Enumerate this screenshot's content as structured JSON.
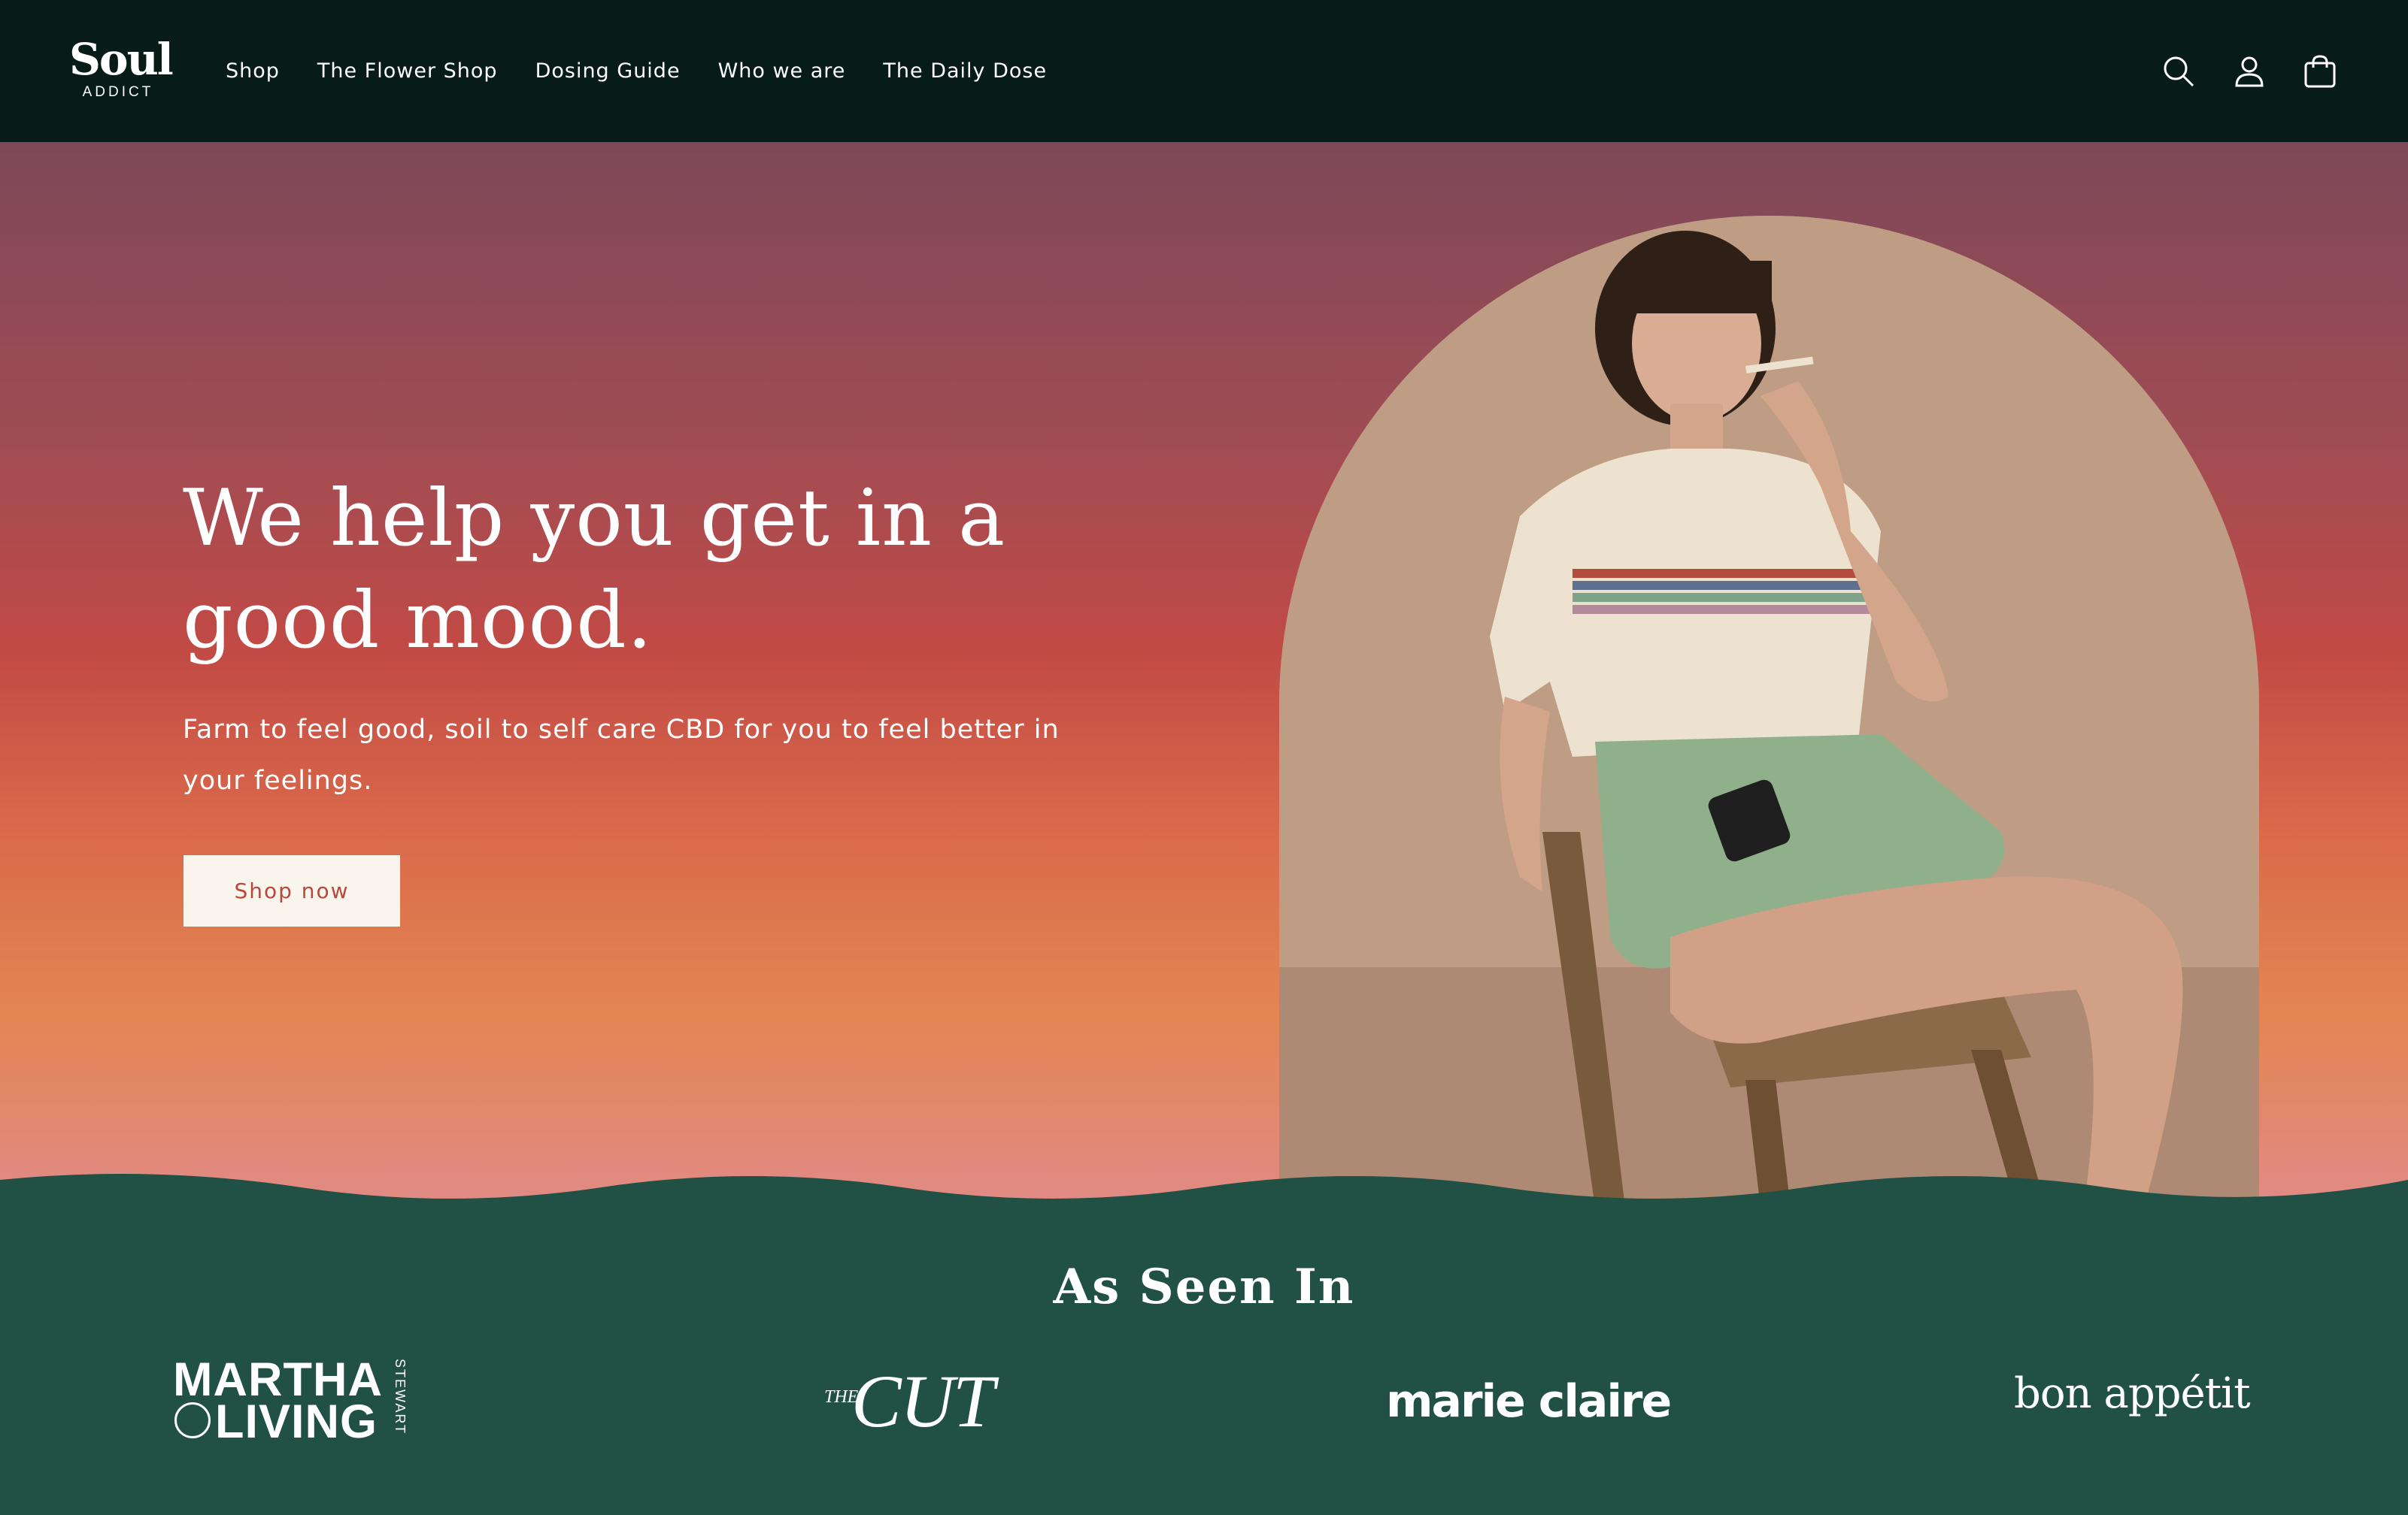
{
  "header": {
    "logo_main": "Soul",
    "logo_sub": "ADDICT",
    "nav": [
      "Shop",
      "The Flower Shop",
      "Dosing Guide",
      "Who we are",
      "The Daily Dose"
    ],
    "icons": [
      "search-icon",
      "account-icon",
      "cart-icon"
    ]
  },
  "hero": {
    "title": "We help you get in a good mood.",
    "subtitle": "Farm to feel good, soil to self care CBD for you to feel better in your feelings.",
    "cta_label": "Shop now"
  },
  "as_seen_in": {
    "title": "As Seen In",
    "martha_line1": "MARTHA",
    "martha_line2": "LIVING",
    "martha_vertical": "STEWART",
    "cut_small": "THE",
    "cut_main": "CUT",
    "marie_claire": "marie claire",
    "bon_appetit": "bon appétit"
  },
  "colors": {
    "header_bg": "#071b17",
    "footer_bg": "#215045",
    "button_bg": "#faf5ec",
    "button_text": "#b9483c"
  }
}
